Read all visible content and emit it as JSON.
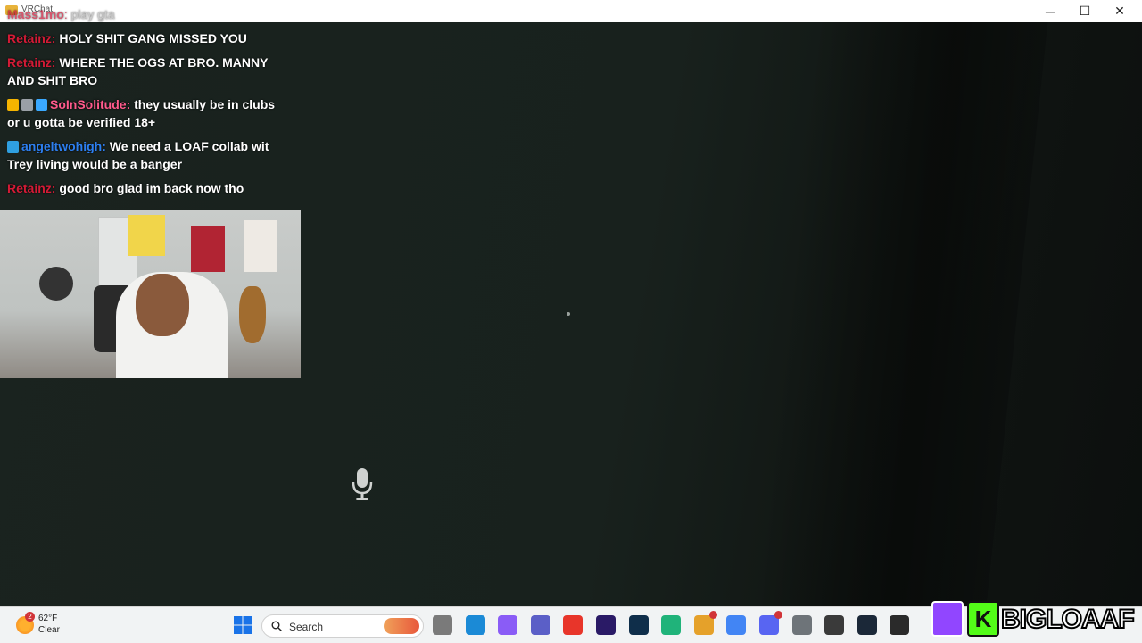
{
  "window": {
    "title": "VRChat",
    "controls": {
      "minimize": "─",
      "maximize": "☐",
      "close": "✕"
    }
  },
  "chat": {
    "messages": [
      {
        "user": "Mass1mo",
        "user_color": "#c91d3c",
        "text": "play gta",
        "faded": true
      },
      {
        "user": "Retainz",
        "user_color": "#d41b36",
        "text": "HOLY SHIT GANG MISSED YOU"
      },
      {
        "user": "Retainz",
        "user_color": "#d41b36",
        "text": "WHERE THE OGS AT BRO. MANNY AND SHIT BRO"
      },
      {
        "user": "SoInSolitude",
        "user_color": "#ff5a8c",
        "text": "they usually be in clubs or u gotta be verified 18+",
        "badges": [
          "crown",
          "bits",
          "cube"
        ]
      },
      {
        "user": "angeltwohigh",
        "user_color": "#2d7ff0",
        "text": "We need a LOAF collab wit Trey living would be a banger",
        "badges": [
          "pin"
        ]
      },
      {
        "user": "Retainz",
        "user_color": "#d41b36",
        "text": "good bro glad im back now tho"
      }
    ]
  },
  "taskbar": {
    "weather": {
      "temp": "62°F",
      "condition": "Clear",
      "alert_count": "2"
    },
    "search": {
      "label": "Search"
    },
    "apps": [
      {
        "name": "task-view",
        "color": "#7a7a7a"
      },
      {
        "name": "edge",
        "color": "#1b8ad6"
      },
      {
        "name": "copilot",
        "color": "#8a5cf6"
      },
      {
        "name": "teams",
        "color": "#5b5fc7"
      },
      {
        "name": "red-app",
        "color": "#e8352a"
      },
      {
        "name": "premiere",
        "color": "#2a1a66"
      },
      {
        "name": "photoshop",
        "color": "#0f2e4a"
      },
      {
        "name": "streamlabs",
        "color": "#20b37a"
      },
      {
        "name": "chrome-canary",
        "color": "#e5a12a"
      },
      {
        "name": "chrome",
        "color": "#4285f4"
      },
      {
        "name": "discord",
        "color": "#5865f2"
      },
      {
        "name": "settings",
        "color": "#6e7479"
      },
      {
        "name": "obs",
        "color": "#3a3a3a"
      },
      {
        "name": "steam",
        "color": "#1b2838"
      },
      {
        "name": "vrchat",
        "color": "#2a2a2a"
      }
    ]
  },
  "brand": {
    "name": "BIGLOAAF",
    "twitch_color": "#9146ff",
    "kick_color": "#53fc18",
    "kick_letter": "K"
  }
}
